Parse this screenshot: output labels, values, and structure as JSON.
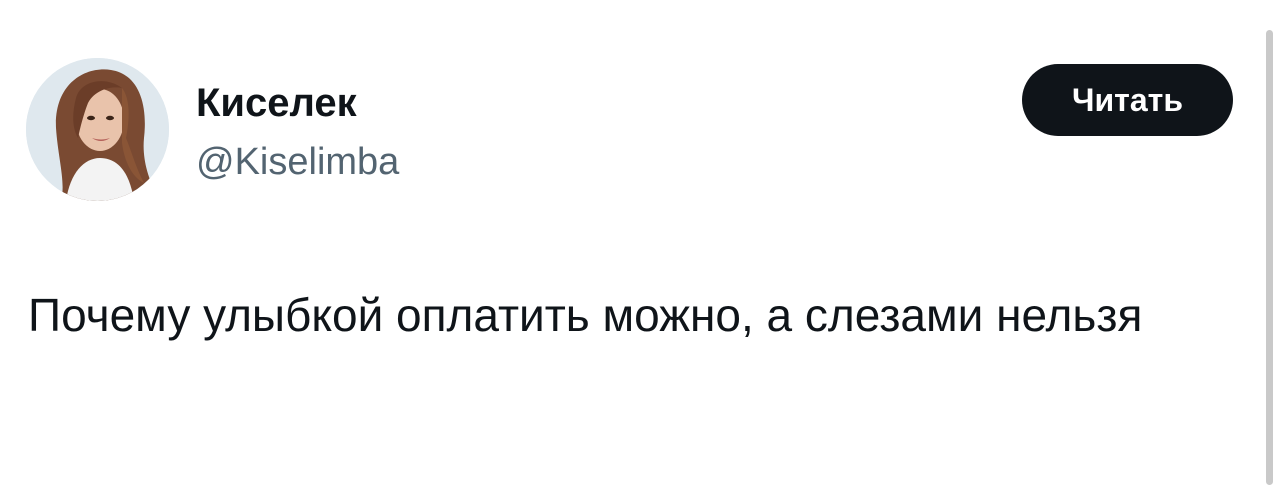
{
  "tweet": {
    "author": {
      "display_name": "Киселек",
      "handle": "@Kiselimba",
      "avatar": "profile-photo"
    },
    "follow_button": {
      "label": "Читать",
      "color": "#0f1419"
    },
    "text": "Почему улыбкой оплатить можно, а слезами нельзя"
  },
  "colors": {
    "text_primary": "#0f1419",
    "text_secondary": "#536471",
    "background": "#ffffff"
  }
}
